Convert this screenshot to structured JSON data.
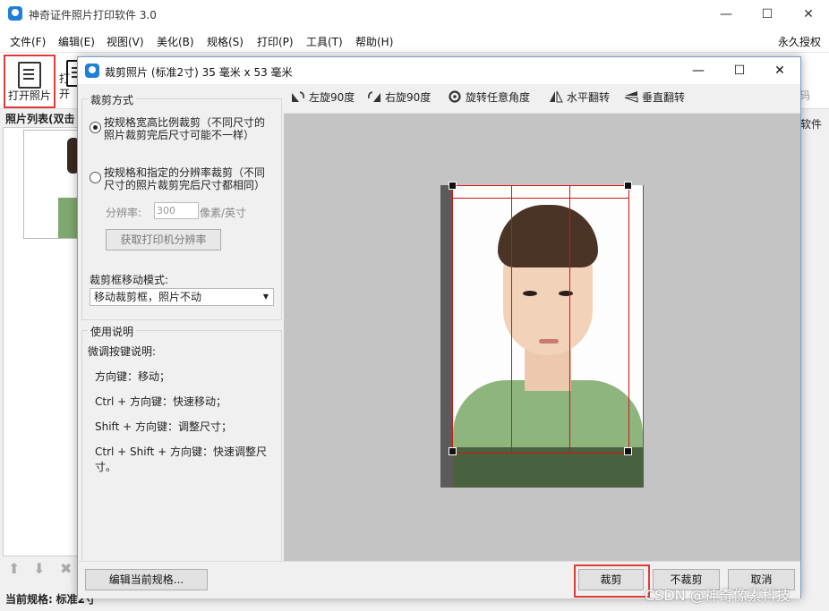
{
  "app": {
    "title": "神奇证件照片打印软件 3.0",
    "menu": [
      "文件(F)",
      "编辑(E)",
      "视图(V)",
      "美化(B)",
      "规格(S)",
      "打印(P)",
      "工具(T)",
      "帮助(H)"
    ],
    "license": "永久授权",
    "toolbar": [
      {
        "label": "打开照片",
        "icon": "open-photo-icon"
      },
      {
        "label": "打开",
        "icon": "open-icon"
      }
    ],
    "photo_list_title": "照片列表(双击",
    "status_label": "当前规格:",
    "status_value": "标准2寸",
    "right_hint_1": "码",
    "right_hint_2": "软件"
  },
  "dialog": {
    "title": "裁剪照片 (标准2寸) 35 毫米 x 53 毫米",
    "crop_group_title": "裁剪方式",
    "radio1": "按规格宽高比例裁剪（不同尺寸的照片裁剪完后尺寸可能不一样）",
    "radio1_line1": "按规格宽高比例裁剪（不同尺寸的",
    "radio1_line2": "照片裁剪完后尺寸可能不一样）",
    "radio2_line1": "按规格和指定的分辨率裁剪（不同",
    "radio2_line2": "尺寸的照片裁剪完后尺寸都相同）",
    "dpi_label": "分辨率:",
    "dpi_value": "300",
    "dpi_unit": "像素/英寸",
    "get_dpi_button": "获取打印机分辨率",
    "move_mode_label": "裁剪框移动模式:",
    "move_mode_value": "移动裁剪框，照片不动",
    "help_group_title": "使用说明",
    "help_lines": [
      "微调按键说明:",
      "方向键：移动；",
      "Ctrl + 方向键：快速移动；",
      "Shift + 方向键：调整尺寸；",
      "Ctrl + Shift + 方向键：快速调整尺寸。"
    ],
    "tools": [
      {
        "label": "左旋90度",
        "icon": "rotate-left-icon"
      },
      {
        "label": "右旋90度",
        "icon": "rotate-right-icon"
      },
      {
        "label": "旋转任意角度",
        "icon": "rotate-any-icon"
      },
      {
        "label": "水平翻转",
        "icon": "flip-horizontal-icon"
      },
      {
        "label": "垂直翻转",
        "icon": "flip-vertical-icon"
      }
    ],
    "edit_spec_button": "编辑当前规格...",
    "crop_button": "裁剪",
    "no_crop_button": "不裁剪",
    "cancel_button": "取消"
  },
  "watermark": "CSDN @神奇像素科技",
  "colors": {
    "accent": "#1e7fd8",
    "highlight": "#e03a3a",
    "crop_frame": "#d01515"
  }
}
